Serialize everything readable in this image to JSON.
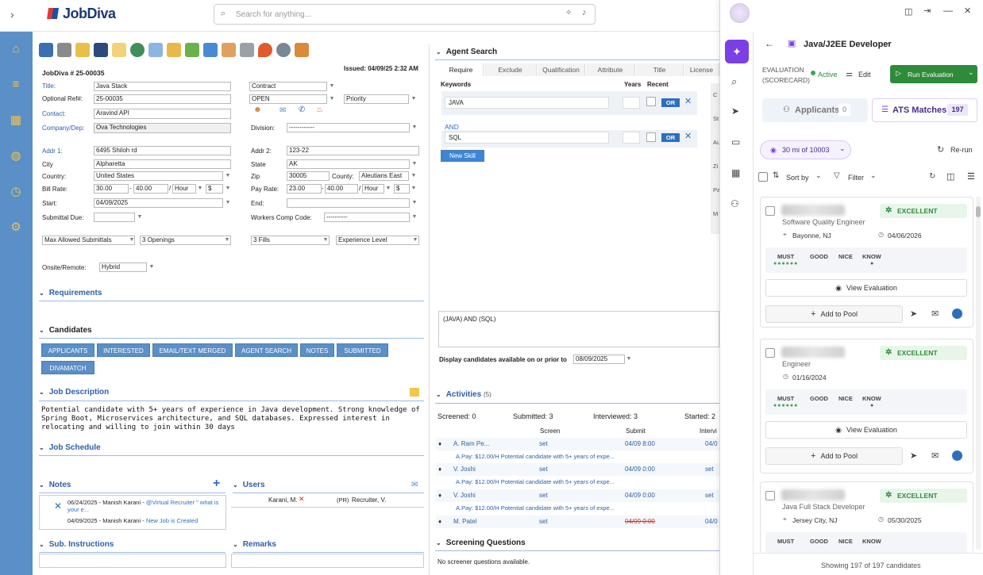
{
  "app": {
    "logo": "JobDiva",
    "search_placeholder": "Search for anything..."
  },
  "job": {
    "number": "JobDiva # 25-00035",
    "issued": "Issued: 04/09/25 2:32 AM",
    "labels": {
      "title": "Title:",
      "optional_ref": "Optional Ref#:",
      "contact": "Contact:",
      "company": "Company/Dep:",
      "division": "Division:",
      "addr1": "Addr 1:",
      "addr2": "Addr 2:",
      "city": "City",
      "state": "State",
      "country": "Country:",
      "zip": "Zip",
      "county": "County:",
      "bill_rate": "Bill Rate:",
      "pay_rate": "Pay Rate:",
      "start": "Start:",
      "end": "End:",
      "submittal_due": "Submittal Due:",
      "workers_comp": "Workers Comp Code:",
      "onsite": "Onsite/Remote:"
    },
    "values": {
      "title": "Java Stack",
      "type": "Contract",
      "optional_ref": "25-00035",
      "status": "OPEN",
      "priority": "Priority",
      "contact": "Aravind API",
      "company": "Ova Technologies",
      "division": "------------",
      "addr1": "6495 Shiloh rd",
      "addr2": "123-22",
      "city": "Alpharetta",
      "state": "AK",
      "country": "United States",
      "zip": "30005",
      "county": "Aleutians East",
      "bill_from": "30.00",
      "bill_to": "40.00",
      "bill_unit": "Hour",
      "bill_cur": "$",
      "pay_from": "23.00",
      "pay_to": "40.00",
      "pay_unit": "Hour",
      "pay_cur": "$",
      "start": "04/09/2025",
      "end": "",
      "submittal_due": "",
      "workers_comp": "----------",
      "max_submittals": "Max Allowed Submittals",
      "openings": "3 Openings",
      "fills": "3 Fills",
      "experience": "Experience Level",
      "onsite": "Hybrid"
    }
  },
  "sections": {
    "requirements": "Requirements",
    "candidates": "Candidates",
    "job_description": "Job Description",
    "job_schedule": "Job Schedule",
    "notes": "Notes",
    "users": "Users",
    "sub_instructions": "Sub. Instructions",
    "remarks": "Remarks"
  },
  "candidate_buttons": [
    "APPLICANTS",
    "INTERESTED",
    "EMAIL/TEXT MERGED",
    "AGENT SEARCH",
    "NOTES",
    "SUBMITTED",
    "DIVAMATCH"
  ],
  "job_description": "Potential candidate with 5+ years of experience in Java development. Strong knowledge of Spring Boot, Microservices architecture, and SQL databases. Expressed interest in relocating and willing to join within 30 days",
  "notes": [
    {
      "date": "06/24/2025 - Manish Karani -",
      "text": "@Virtual Recruiter \" what is your e..."
    },
    {
      "date": "04/09/2025 - Manish Karani -",
      "text": "New Job is Created"
    }
  ],
  "users": {
    "name": "Karani, M.",
    "role": "(PR)",
    "recruiter": "Recruiter, V."
  },
  "agent_search": {
    "title": "Agent Search",
    "tabs": [
      "Require",
      "Exclude",
      "Qualification",
      "Attribute",
      "Title",
      "License"
    ],
    "col_keywords": "Keywords",
    "col_years": "Years",
    "col_recent": "Recent",
    "kw1": "JAVA",
    "and": "AND",
    "kw2": "SQL",
    "or": "OR",
    "new_skill": "New Skill",
    "query": "(JAVA) AND (SQL)",
    "display_label": "Display candidates available on or prior to",
    "display_date": "08/09/2025"
  },
  "activities": {
    "title": "Activities",
    "count": "(5)",
    "screened": "Screened: 0",
    "submitted": "Submitted: 3",
    "interviewed": "Interviewed: 3",
    "started": "Started: 2",
    "cols": [
      "Screen",
      "Submit",
      "Intervi"
    ],
    "rows": [
      {
        "name": "A. Ram Pe...",
        "screen": "set",
        "submit": "04/09 8:00",
        "interv": "04/0",
        "note": "A.Pay: $12.00/H Potential candidate with 5+ years of expe..."
      },
      {
        "name": "V. Joshi",
        "screen": "set",
        "submit": "04/09 0:00",
        "interv": "set",
        "note": "A.Pay: $12.00/H Potential candidate with 5+ years of expe..."
      },
      {
        "name": "V. Joshi",
        "screen": "set",
        "submit": "04/09 0:00",
        "interv": "set",
        "note": "A.Pay: $12.00/H Potential candidate with 5+ years of expe..."
      },
      {
        "name": "M. Patel",
        "screen": "set",
        "submit": "04/09 0:00",
        "interv": "04/0",
        "note": ""
      }
    ]
  },
  "screening": {
    "title": "Screening Questions",
    "text": "No screener questions available."
  },
  "right": {
    "job_title": "Java/J2EE Developer",
    "eval_label": "EVALUATION",
    "eval_sub": "(SCORECARD)",
    "active": "Active",
    "edit": "Edit",
    "run": "Run Evaluation",
    "applicants": "Applicants",
    "applicants_count": "0",
    "ats": "ATS Matches",
    "ats_count": "197",
    "radius": "30 mi of 10003",
    "rerun": "Re-run",
    "sort": "Sort by",
    "filter": "Filter",
    "cards": [
      {
        "title": "Software Quality Engineer",
        "location": "Bayonne, NJ",
        "date": "04/06/2026",
        "rating": "EXCELLENT"
      },
      {
        "title": "Engineer",
        "location": "",
        "date": "01/16/2024",
        "rating": "EXCELLENT"
      },
      {
        "title": "Java Full Stack Developer",
        "location": "Jersey City, NJ",
        "date": "05/30/2025",
        "rating": "EXCELLENT"
      }
    ],
    "must": "MUST",
    "good": "GOOD",
    "nice": "NICE",
    "know": "KNOW",
    "view_eval": "View Evaluation",
    "add_pool": "Add to Pool",
    "footer": "Showing 197 of 197 candidates"
  },
  "colors": {
    "brand": "#5b8fc7",
    "green": "#2e8b3a",
    "purple": "#7b3fe4"
  }
}
